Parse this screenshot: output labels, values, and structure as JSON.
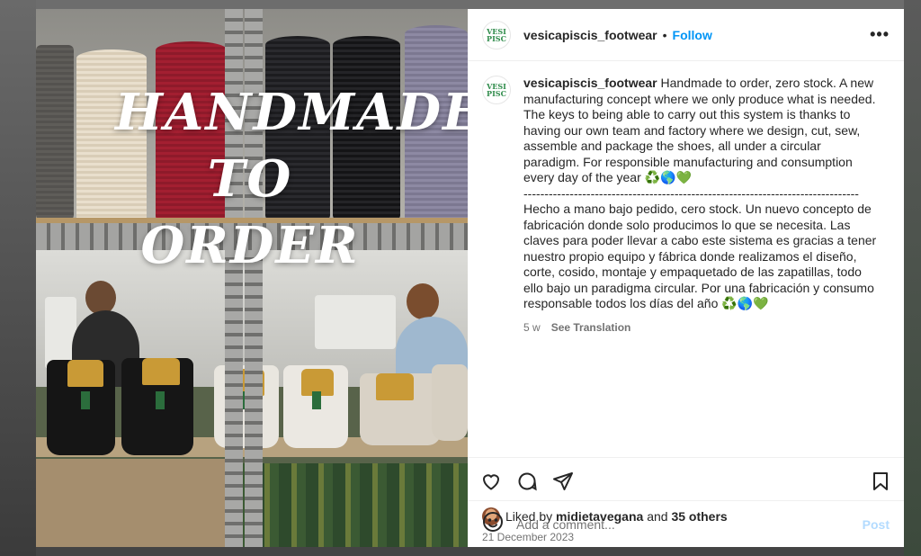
{
  "post_image": {
    "headline_line1": "HANDMADE",
    "headline_line2": "TO ORDER"
  },
  "header": {
    "avatar_text": "VESI\nPISC",
    "username": "vesicapiscis_footwear",
    "separator": "•",
    "follow_label": "Follow",
    "more_label": "•••"
  },
  "caption": {
    "username": "vesicapiscis_footwear",
    "text": " Handmade to order, zero stock. A new manufacturing concept where we only produce what is needed. The keys to being able to carry out this system is thanks to having our own team and factory where we design, cut, sew, assemble and package the shoes, all under a circular paradigm. For responsible manufacturing and consumption every day of the year ♻️🌎💚\n--------------------------------------------------------------------------------\nHecho a mano bajo pedido, cero stock. Un nuevo concepto de fabricación donde solo producimos lo que se necesita. Las claves para poder llevar a cabo este sistema es gracias a tener nuestro propio equipo y fábrica donde realizamos el diseño, corte, cosido, montaje y empaquetado de las zapatillas, todo ello bajo un paradigma circular. Por una fabricación y consumo responsable todos los días del año ♻️🌎💚",
    "age": "5 w",
    "see_translation": "See Translation"
  },
  "actions": {
    "like_icon": "heart-icon",
    "comment_icon": "comment-icon",
    "share_icon": "share-icon",
    "save_icon": "bookmark-icon"
  },
  "likes": {
    "prefix": "Liked by ",
    "user": "midietavegana",
    "middle": " and ",
    "others": "35 others"
  },
  "date": "21 December 2023",
  "comment_box": {
    "placeholder": "Add a comment...",
    "post_label": "Post"
  },
  "colors": {
    "accent": "#0095f6",
    "post_disabled": "#b3dbff",
    "text": "#262626",
    "muted": "#737373"
  }
}
